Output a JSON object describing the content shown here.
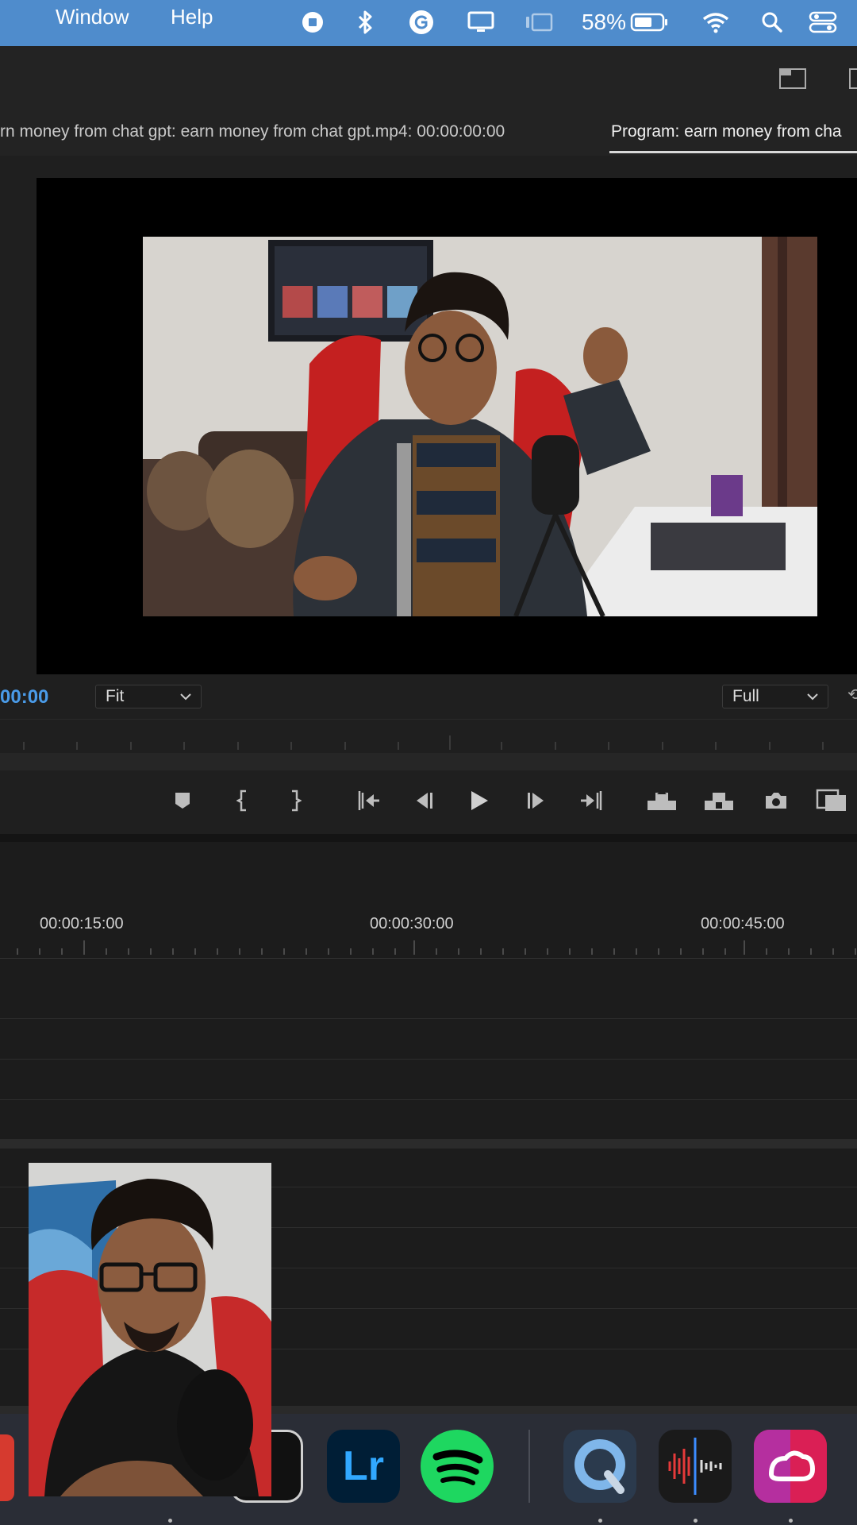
{
  "menubar": {
    "items": [
      {
        "label": "Window"
      },
      {
        "label": "Help"
      }
    ],
    "battery_percent": "58%",
    "status_icons": [
      "record-icon",
      "bluetooth-icon",
      "grammarly-icon",
      "display-icon",
      "stage-manager-icon",
      "battery-icon",
      "wifi-icon",
      "spotlight-search-icon",
      "control-center-icon"
    ]
  },
  "source_monitor": {
    "tab_title": "rn money from chat gpt: earn money from chat gpt.mp4: 00:00:00:00"
  },
  "program_monitor": {
    "tab_title": "Program: earn money from cha",
    "timecode": "00:00",
    "zoom_select": "Fit",
    "resolution_select": "Full",
    "transport_buttons": [
      "add-marker",
      "mark-in",
      "mark-out",
      "go-to-in",
      "step-back",
      "play",
      "step-forward",
      "go-to-out",
      "lift",
      "extract",
      "export-frame",
      "insert-compare"
    ]
  },
  "timeline": {
    "timecodes": [
      "00:00:15:00",
      "00:00:30:00",
      "00:00:45:00"
    ]
  },
  "dock": {
    "apps": [
      {
        "name": "Lightroom",
        "label": "Lr"
      },
      {
        "name": "Spotify"
      },
      {
        "name": "QuickTime Player"
      },
      {
        "name": "Voice Memos"
      },
      {
        "name": "Creative Cloud"
      }
    ]
  },
  "colors": {
    "menubar": "#4f8ccc",
    "panel_bg": "#1f1f1f",
    "timecode_blue": "#4a9be8",
    "lightroom_blue": "#31a8ff",
    "spotify_green": "#1ed760"
  }
}
